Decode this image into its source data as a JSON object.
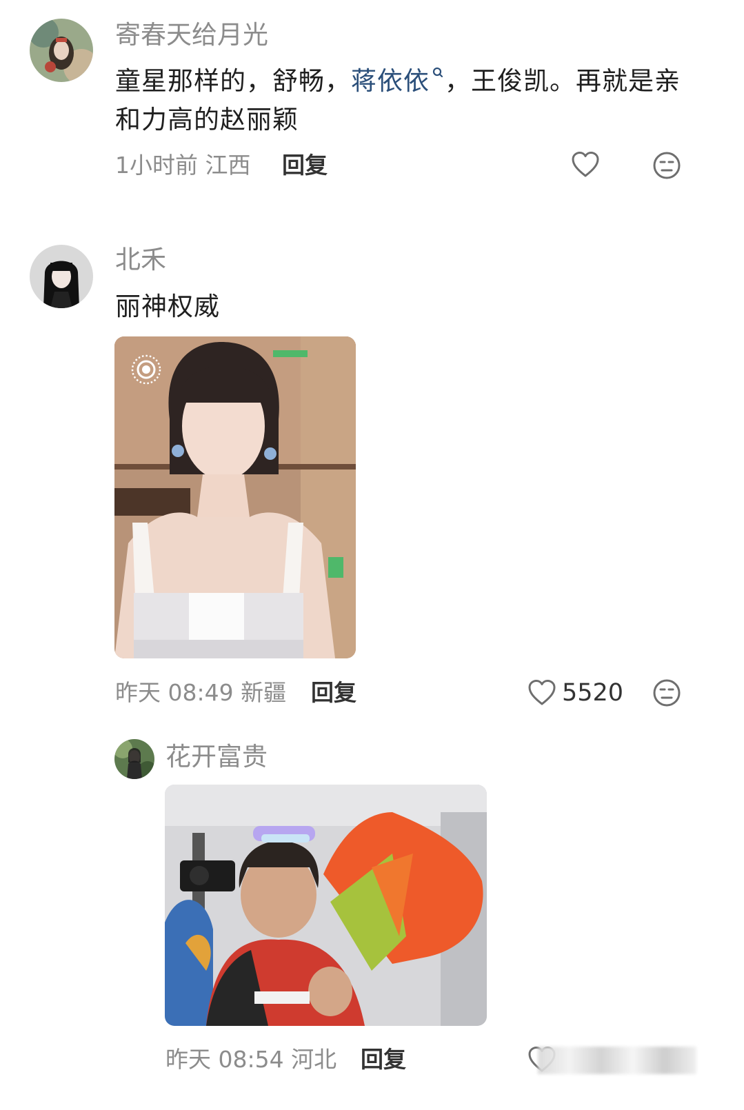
{
  "comments": [
    {
      "username": "寄春天给月光",
      "text_before": "童星那样的，舒畅，",
      "topic": "蒋依依",
      "text_after": "，王俊凯。再就是亲和力高的赵丽颖",
      "time_location": "1小时前 江西",
      "reply_label": "回复"
    },
    {
      "username": "北禾",
      "text": "丽神权威",
      "time_location": "昨天 08:49 新疆",
      "reply_label": "回复",
      "like_count": "5520"
    }
  ],
  "sub_reply": {
    "username": "花开富贵",
    "time_location": "昨天 08:54 河北",
    "reply_label": "回复"
  },
  "icons": {
    "like": "heart-outline-icon",
    "dislike": "neutral-face-icon",
    "live_photo": "live-photo-icon",
    "topic_search": "search-icon"
  },
  "colors": {
    "background": "#ffffff",
    "username": "#8c8c8c",
    "body_text": "#1f1f1f",
    "topic_link": "#2b4f7a",
    "meta": "#8c8c8c"
  }
}
